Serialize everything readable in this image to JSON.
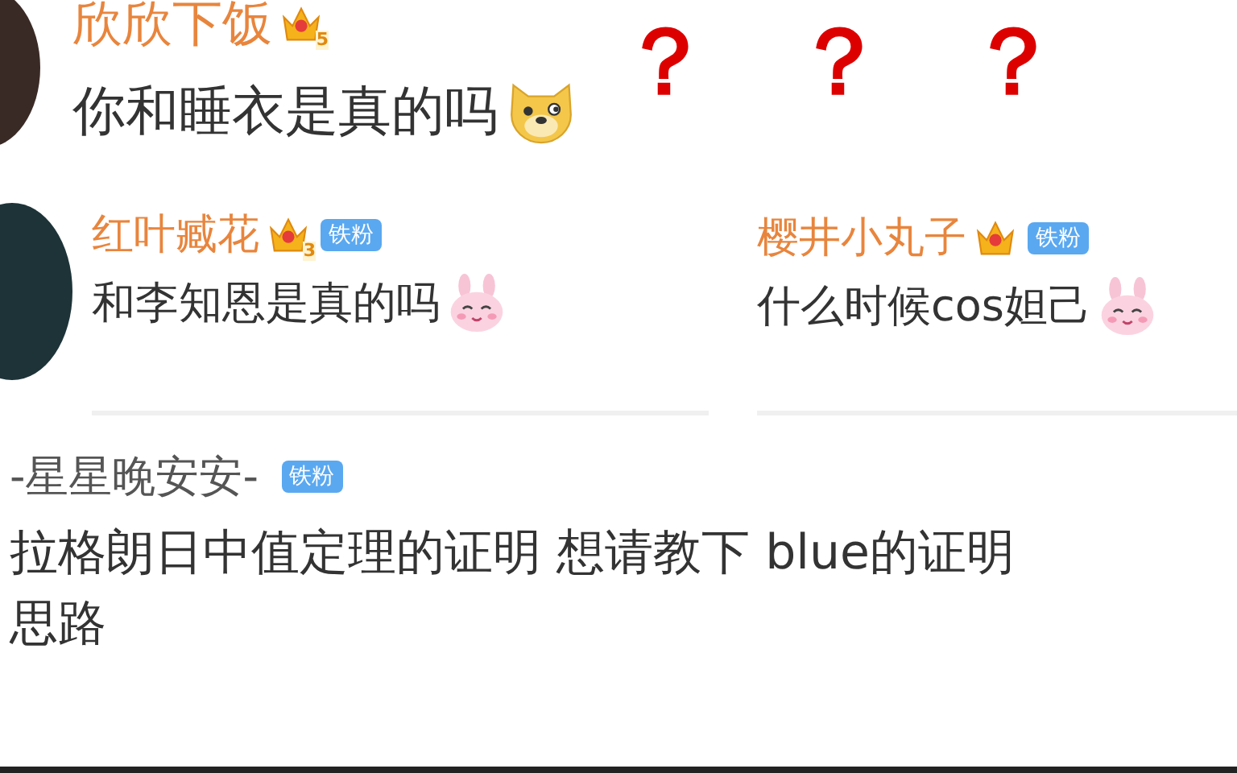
{
  "top_comment": {
    "user": "欣欣下饭",
    "crown": true,
    "level": "5",
    "text": "你和睡衣是真的吗",
    "emoji": {
      "kind": "dog"
    },
    "avatar": true
  },
  "question_marks": [
    "？",
    "？",
    "？"
  ],
  "middle_comments": [
    {
      "user": "红叶臧花",
      "crown": true,
      "level": "3",
      "fan_badge": "铁粉",
      "text": "和李知恩是真的吗",
      "emoji": {
        "kind": "bunny"
      },
      "avatar": true
    },
    {
      "user": "樱井小丸子",
      "crown": true,
      "fan_badge": "铁粉",
      "text": "什么时候cos妲己",
      "emoji": {
        "kind": "bunny"
      },
      "avatar": false
    }
  ],
  "bottom_comment": {
    "user": "-星星晚安安-",
    "crown": false,
    "fan_badge": "铁粉",
    "text": "拉格朗日中值定理的证明 想请教下 blue的证明思路"
  }
}
